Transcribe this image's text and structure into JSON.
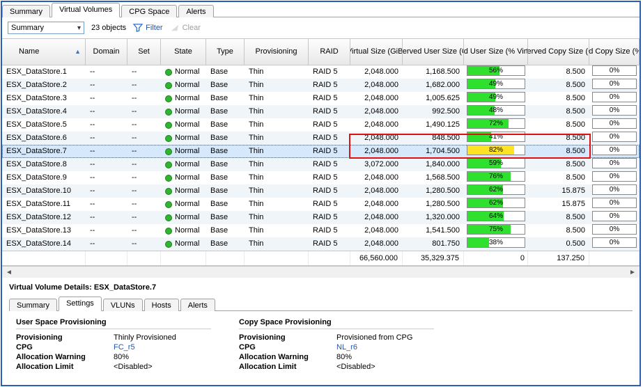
{
  "top_tabs": [
    "Summary",
    "Virtual Volumes",
    "CPG Space",
    "Alerts"
  ],
  "top_tab_active": 1,
  "toolbar": {
    "combo_value": "Summary",
    "object_count": "23 objects",
    "filter_label": "Filter",
    "clear_label": "Clear"
  },
  "columns": [
    {
      "key": "name",
      "label": "Name",
      "sort": "asc"
    },
    {
      "key": "domain",
      "label": "Domain"
    },
    {
      "key": "set",
      "label": "Set"
    },
    {
      "key": "state",
      "label": "State"
    },
    {
      "key": "type",
      "label": "Type"
    },
    {
      "key": "prov",
      "label": "Provisioning"
    },
    {
      "key": "raid",
      "label": "RAID"
    },
    {
      "key": "vsize",
      "label": "Virtual Size (GiB)"
    },
    {
      "key": "rusize",
      "label": "Reserved User Size (GiB)"
    },
    {
      "key": "used",
      "label": "Used User Size (% Virtual)"
    },
    {
      "key": "rcopy",
      "label": "Reserved Copy Size (GiB)"
    },
    {
      "key": "rcpct",
      "label": "Reserved Copy Size (% Virtual)"
    }
  ],
  "rows": [
    {
      "name": "ESX_DataStore.1",
      "domain": "--",
      "set": "--",
      "state": "Normal",
      "type": "Base",
      "prov": "Thin",
      "raid": "RAID 5",
      "vsize": "2,048.000",
      "rusize": "1,168.500",
      "usedpct": 56,
      "rcopy": "8.500",
      "rcpct": 0
    },
    {
      "name": "ESX_DataStore.2",
      "domain": "--",
      "set": "--",
      "state": "Normal",
      "type": "Base",
      "prov": "Thin",
      "raid": "RAID 5",
      "vsize": "2,048.000",
      "rusize": "1,682.000",
      "usedpct": 49,
      "rcopy": "8.500",
      "rcpct": 0
    },
    {
      "name": "ESX_DataStore.3",
      "domain": "--",
      "set": "--",
      "state": "Normal",
      "type": "Base",
      "prov": "Thin",
      "raid": "RAID 5",
      "vsize": "2,048.000",
      "rusize": "1,005.625",
      "usedpct": 49,
      "rcopy": "8.500",
      "rcpct": 0
    },
    {
      "name": "ESX_DataStore.4",
      "domain": "--",
      "set": "--",
      "state": "Normal",
      "type": "Base",
      "prov": "Thin",
      "raid": "RAID 5",
      "vsize": "2,048.000",
      "rusize": "992.500",
      "usedpct": 48,
      "rcopy": "8.500",
      "rcpct": 0
    },
    {
      "name": "ESX_DataStore.5",
      "domain": "--",
      "set": "--",
      "state": "Normal",
      "type": "Base",
      "prov": "Thin",
      "raid": "RAID 5",
      "vsize": "2,048.000",
      "rusize": "1,490.125",
      "usedpct": 72,
      "rcopy": "8.500",
      "rcpct": 0
    },
    {
      "name": "ESX_DataStore.6",
      "domain": "--",
      "set": "--",
      "state": "Normal",
      "type": "Base",
      "prov": "Thin",
      "raid": "RAID 5",
      "vsize": "2,048.000",
      "rusize": "848.500",
      "usedpct": 41,
      "rcopy": "8.500",
      "rcpct": 0
    },
    {
      "name": "ESX_DataStore.7",
      "domain": "--",
      "set": "--",
      "state": "Normal",
      "type": "Base",
      "prov": "Thin",
      "raid": "RAID 5",
      "vsize": "2,048.000",
      "rusize": "1,704.500",
      "usedpct": 82,
      "warn": true,
      "rcopy": "8.500",
      "rcpct": 0,
      "selected": true,
      "highlight": true
    },
    {
      "name": "ESX_DataStore.8",
      "domain": "--",
      "set": "--",
      "state": "Normal",
      "type": "Base",
      "prov": "Thin",
      "raid": "RAID 5",
      "vsize": "3,072.000",
      "rusize": "1,840.000",
      "usedpct": 59,
      "rcopy": "8.500",
      "rcpct": 0
    },
    {
      "name": "ESX_DataStore.9",
      "domain": "--",
      "set": "--",
      "state": "Normal",
      "type": "Base",
      "prov": "Thin",
      "raid": "RAID 5",
      "vsize": "2,048.000",
      "rusize": "1,568.500",
      "usedpct": 76,
      "rcopy": "8.500",
      "rcpct": 0
    },
    {
      "name": "ESX_DataStore.10",
      "domain": "--",
      "set": "--",
      "state": "Normal",
      "type": "Base",
      "prov": "Thin",
      "raid": "RAID 5",
      "vsize": "2,048.000",
      "rusize": "1,280.500",
      "usedpct": 62,
      "rcopy": "15.875",
      "rcpct": 0
    },
    {
      "name": "ESX_DataStore.11",
      "domain": "--",
      "set": "--",
      "state": "Normal",
      "type": "Base",
      "prov": "Thin",
      "raid": "RAID 5",
      "vsize": "2,048.000",
      "rusize": "1,280.500",
      "usedpct": 62,
      "rcopy": "15.875",
      "rcpct": 0
    },
    {
      "name": "ESX_DataStore.12",
      "domain": "--",
      "set": "--",
      "state": "Normal",
      "type": "Base",
      "prov": "Thin",
      "raid": "RAID 5",
      "vsize": "2,048.000",
      "rusize": "1,320.000",
      "usedpct": 64,
      "rcopy": "8.500",
      "rcpct": 0
    },
    {
      "name": "ESX_DataStore.13",
      "domain": "--",
      "set": "--",
      "state": "Normal",
      "type": "Base",
      "prov": "Thin",
      "raid": "RAID 5",
      "vsize": "2,048.000",
      "rusize": "1,541.500",
      "usedpct": 75,
      "rcopy": "8.500",
      "rcpct": 0
    },
    {
      "name": "ESX_DataStore.14",
      "domain": "--",
      "set": "--",
      "state": "Normal",
      "type": "Base",
      "prov": "Thin",
      "raid": "RAID 5",
      "vsize": "2,048.000",
      "rusize": "801.750",
      "usedpct": 38,
      "rcopy": "0.500",
      "rcpct": 0
    }
  ],
  "totals": {
    "vsize": "66,560.000",
    "rusize": "35,329.375",
    "used": "0",
    "rcopy": "137.250",
    "rcpct": ""
  },
  "details": {
    "title": "Virtual Volume Details: ESX_DataStore.7",
    "tabs": [
      "Summary",
      "Settings",
      "VLUNs",
      "Hosts",
      "Alerts"
    ],
    "tab_active": 1,
    "user_space": {
      "heading": "User Space Provisioning",
      "provisioning_label": "Provisioning",
      "provisioning": "Thinly Provisioned",
      "cpg_label": "CPG",
      "cpg": "FC_r5",
      "alloc_warn_label": "Allocation Warning",
      "alloc_warn": "80%",
      "alloc_limit_label": "Allocation Limit",
      "alloc_limit": "<Disabled>"
    },
    "copy_space": {
      "heading": "Copy Space Provisioning",
      "provisioning_label": "Provisioning",
      "provisioning": "Provisioned from CPG",
      "cpg_label": "CPG",
      "cpg": "NL_r6",
      "alloc_warn_label": "Allocation Warning",
      "alloc_warn": "80%",
      "alloc_limit_label": "Allocation Limit",
      "alloc_limit": "<Disabled>"
    }
  },
  "colors": {
    "green": "#2fe02f",
    "yellow": "#ffe223"
  }
}
